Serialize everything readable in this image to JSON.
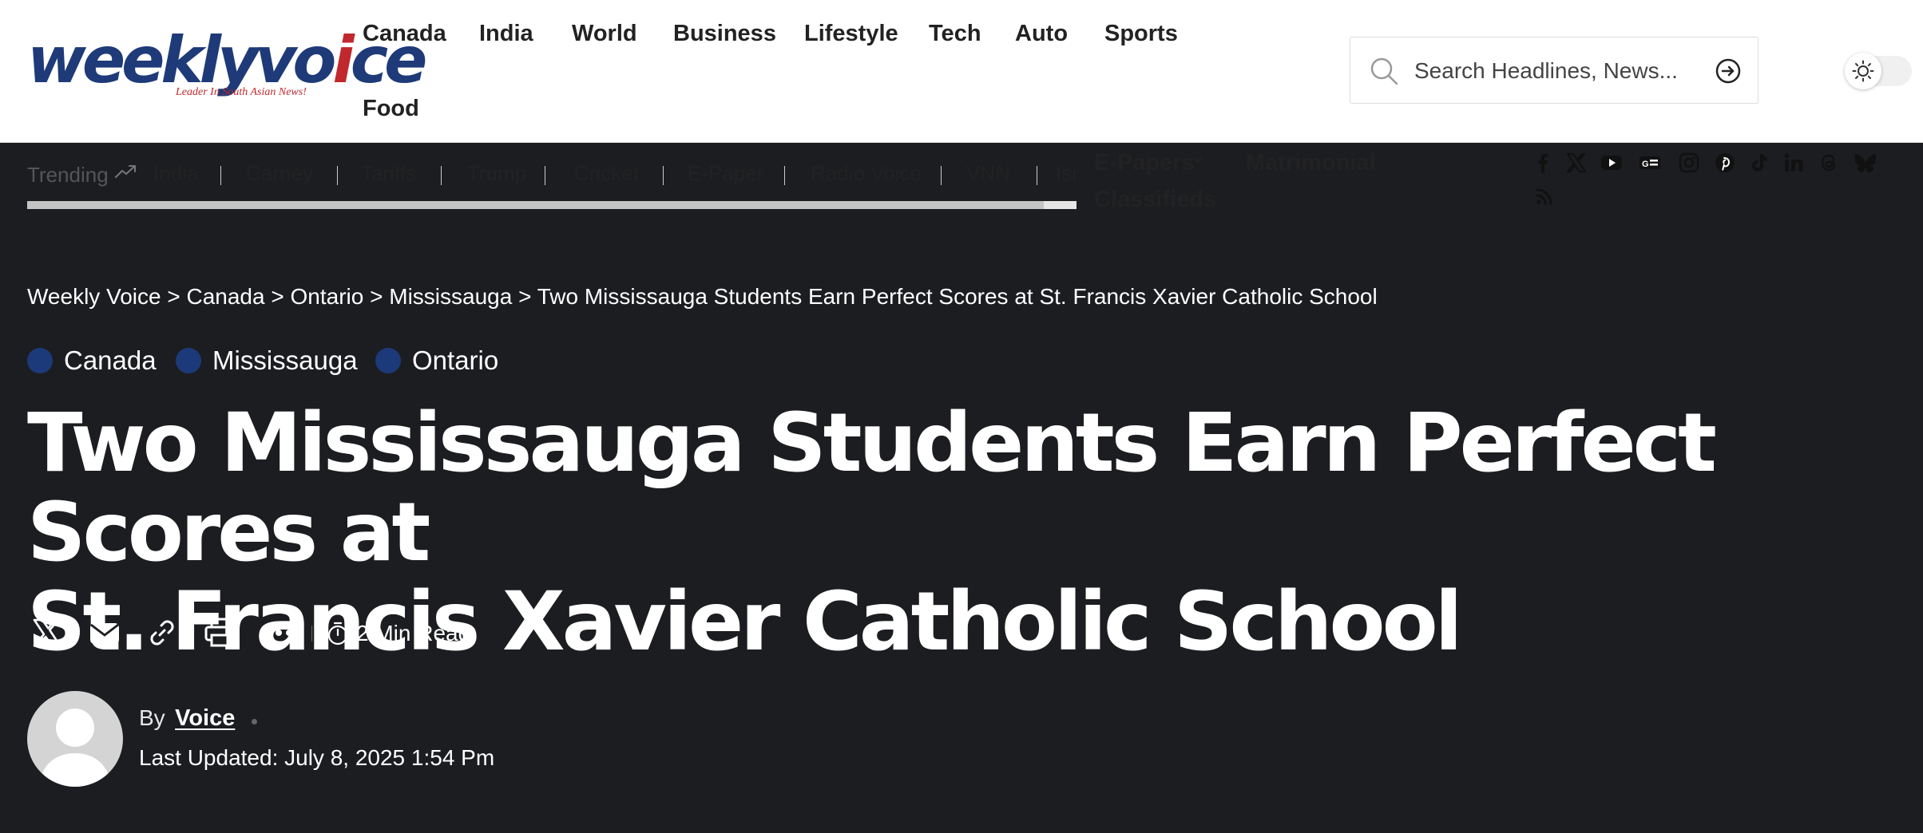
{
  "header": {
    "logo": {
      "text": "weeklyvoice",
      "tagline": "Leader In South Asian News!"
    },
    "nav": [
      "Canada",
      "India",
      "World",
      "Business",
      "Lifestyle",
      "Tech",
      "Auto",
      "Sports",
      "Food"
    ],
    "search": {
      "placeholder": "Search Headlines, News..."
    }
  },
  "trending": {
    "label": "Trending",
    "items": [
      "India",
      "Carney",
      "Tariffs",
      "Trump",
      "Cricket",
      "E-Paper",
      "Radio Voice",
      "VNN",
      "Israel"
    ]
  },
  "quick_links": {
    "epapers": "E-Papers",
    "matrimonial": "Matrimonial",
    "classifieds": "Classifieds"
  },
  "social_icons": [
    "facebook-icon",
    "x-icon",
    "youtube-icon",
    "google-news-icon",
    "instagram-icon",
    "pinterest-icon",
    "tiktok-icon",
    "linkedin-icon",
    "threads-icon",
    "bluesky-icon",
    "rss-icon"
  ],
  "article": {
    "breadcrumb": [
      "Weekly Voice",
      "Canada",
      "Ontario",
      "Mississauga",
      "Two Mississauga Students Earn Perfect Scores at St. Francis Xavier Catholic School"
    ],
    "breadcrumb_sep": ">",
    "categories": [
      "Canada",
      "Mississauga",
      "Ontario"
    ],
    "title_line1": "Two Mississauga Students Earn Perfect Scores at",
    "title_line2": "St. Francis Xavier Catholic School",
    "read_time": "2 Min Read",
    "by_label": "By",
    "author": "Voice",
    "last_updated": "Last Updated: July 8, 2025 1:54 Pm"
  },
  "colors": {
    "dark_bg": "#1c1d21",
    "category_dot": "#1c3a7a",
    "logo_blue": "#1e3a78",
    "logo_red": "#c0282d"
  }
}
